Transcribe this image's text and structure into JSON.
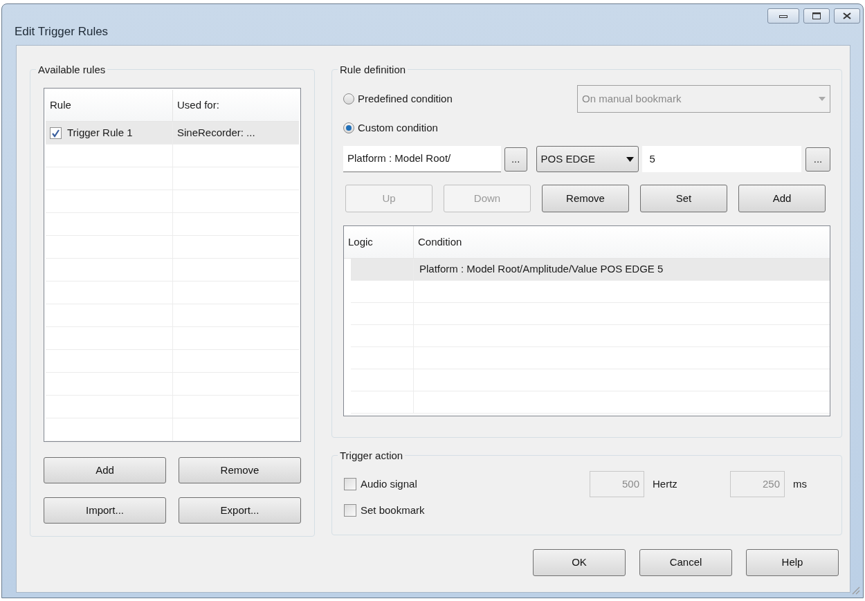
{
  "window": {
    "title": "Edit Trigger Rules"
  },
  "available_rules": {
    "title": "Available rules",
    "columns": [
      "Rule",
      "Used for:"
    ],
    "rows": [
      {
        "rule": "Trigger Rule 1",
        "used_for": "SineRecorder: ...",
        "checked": true,
        "selected": true
      }
    ],
    "buttons": [
      {
        "label": "Add"
      },
      {
        "label": "Remove"
      },
      {
        "label": "Import..."
      },
      {
        "label": "Export..."
      }
    ]
  },
  "rule_definition": {
    "title": "Rule definition",
    "options": [
      {
        "label": "Predefined condition",
        "selected": false
      },
      {
        "label": "Custom condition",
        "selected": true
      }
    ],
    "predefined_dropdown": {
      "value": "On manual bookmark",
      "disabled": true
    },
    "signal_field": {
      "value": "Platform : Model Root/"
    },
    "browse_button": "...",
    "operator_dropdown": {
      "value": "POS EDGE"
    },
    "value_field": {
      "value": "5"
    },
    "value_browse_button": "...",
    "buttons": [
      {
        "label": "Up",
        "disabled": true
      },
      {
        "label": "Down",
        "disabled": true
      },
      {
        "label": "Remove",
        "disabled": false
      },
      {
        "label": "Set",
        "disabled": false
      },
      {
        "label": "Add",
        "disabled": false
      }
    ],
    "table": {
      "columns": [
        "Logic",
        "Condition"
      ],
      "rows": [
        {
          "logic": "",
          "condition": "Platform : Model Root/Amplitude/Value POS EDGE 5",
          "selected": true
        }
      ]
    }
  },
  "trigger_action": {
    "title": "Trigger action",
    "checks": [
      {
        "label": "Audio signal",
        "checked": false
      },
      {
        "label": "Set bookmark",
        "checked": false
      }
    ],
    "frequency": {
      "value": "500",
      "unit": "Hertz",
      "disabled": true
    },
    "duration": {
      "value": "250",
      "unit": "ms",
      "disabled": true
    }
  },
  "buttons": [
    {
      "label": "OK"
    },
    {
      "label": "Cancel"
    },
    {
      "label": "Help"
    }
  ]
}
